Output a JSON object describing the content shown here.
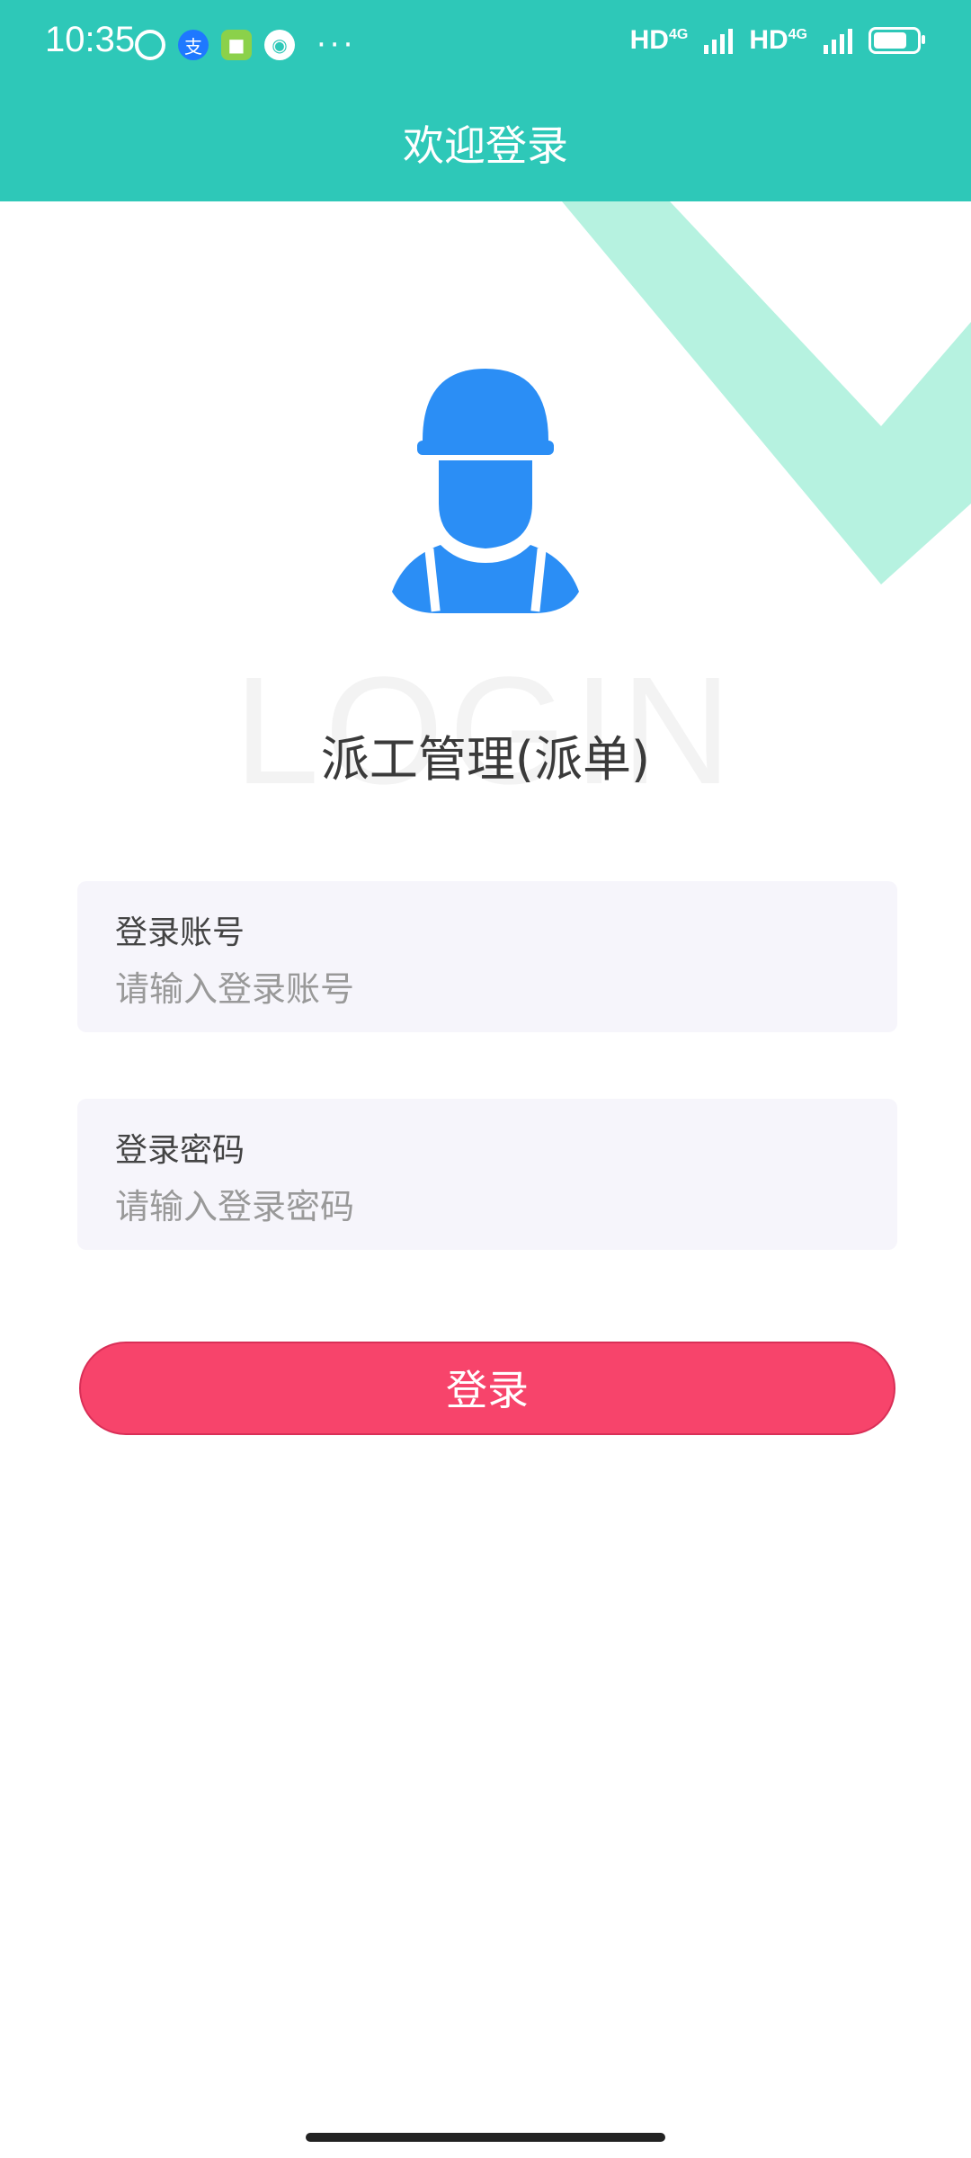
{
  "status_bar": {
    "time": "10:35",
    "network_1": "HD",
    "network_1_type": "4G",
    "network_2": "HD",
    "network_2_type": "4G",
    "icons": [
      "alarm-icon",
      "alipay-icon",
      "app-icon",
      "message-icon"
    ],
    "more": "···"
  },
  "header": {
    "title": "欢迎登录"
  },
  "hero": {
    "watermark": "LOGIN",
    "app_name": "派工管理(派单)",
    "avatar_color": "#2b8ef5",
    "deco_color": "#b6f2e0"
  },
  "form": {
    "account": {
      "label": "登录账号",
      "placeholder": "请输入登录账号",
      "value": ""
    },
    "password": {
      "label": "登录密码",
      "placeholder": "请输入登录密码",
      "value": ""
    }
  },
  "actions": {
    "login_label": "登录",
    "login_color": "#f7446b"
  },
  "colors": {
    "primary": "#2ec8b8",
    "field_bg": "#f6f5fb"
  }
}
